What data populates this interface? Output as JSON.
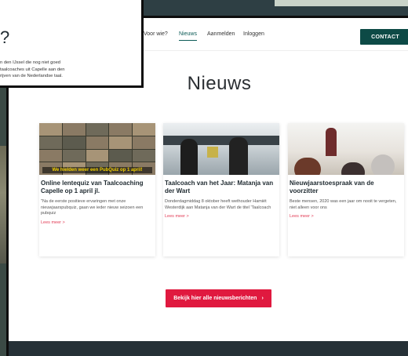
{
  "navbar": {
    "links": [
      {
        "label": "Voor wie?",
        "active": false
      },
      {
        "label": "Nieuws",
        "active": true
      },
      {
        "label": "Aanmelden",
        "active": false
      },
      {
        "label": "Inloggen",
        "active": false
      }
    ],
    "contact_label": "CONTACT"
  },
  "page_title": "Nieuws",
  "cards": [
    {
      "title": "Online lentequiz van Taalcoaching Capelle op 1 april jl.",
      "excerpt": "\"Na de eerste positieve ervaringen met onze nieuwjaarspubquiz, gaan we ieder nieuw seizoen een pubquiz",
      "more": "Lees meer >",
      "image_caption": "We hielden weer een PubQuiz op 1 april!"
    },
    {
      "title": "Taalcoach van het Jaar: Matanja van der Wart",
      "excerpt": "Donderdagmiddag 8 oktober heeft wethouder Hamiët Westerdijk aan Matanja van der Wart de titel 'Taalcoach",
      "more": "Lees meer >"
    },
    {
      "title": "Nieuwjaarstoespraak van de voorzitter",
      "excerpt": "Beste mensen,  2020 was een jaar om nooit te vergeten, niet alleen voor ons",
      "more": "Lees meer >"
    }
  ],
  "all_news_label": "Bekijk hier alle nieuwsberichten",
  "all_news_icon": "›",
  "popup": {
    "question_mark": "?",
    "lines": [
      "n den IJssel die nog niet goed",
      "taalcoaches uit Capelle aan den",
      "rijven van de Nederlandse taal."
    ]
  },
  "colors": {
    "brand_teal": "#0d4a46",
    "accent_red": "#e0193f",
    "link_red": "#e23c55"
  }
}
